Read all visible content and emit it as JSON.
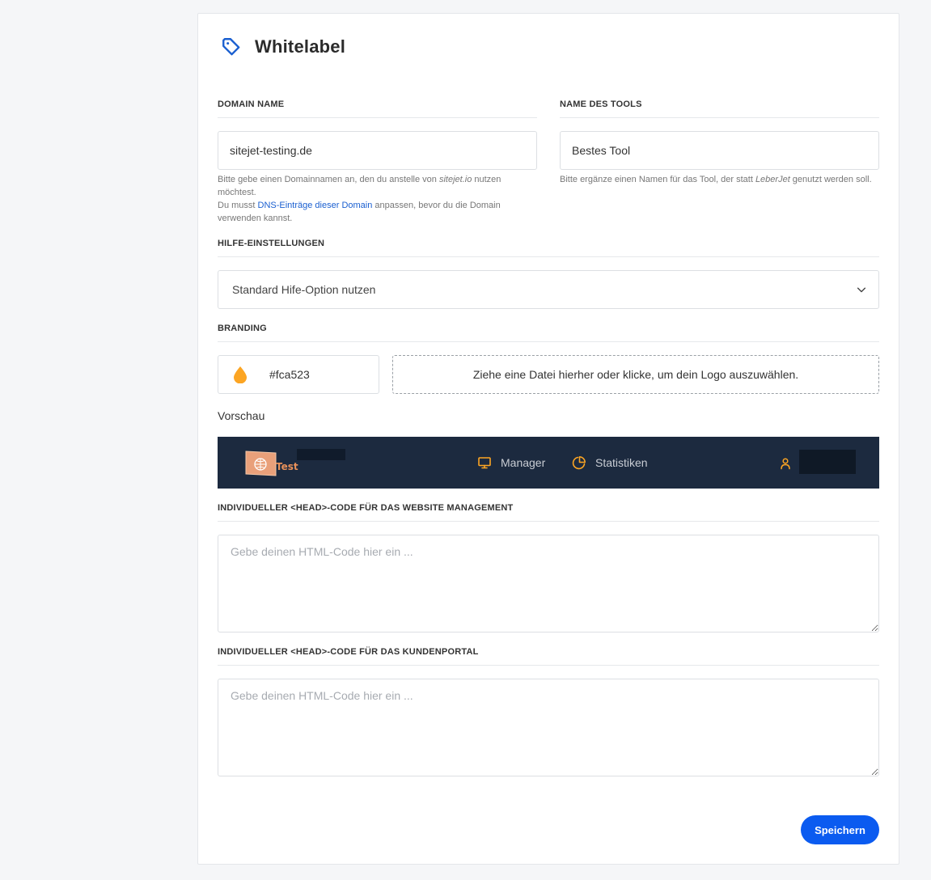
{
  "header": {
    "title": "Whitelabel",
    "icon": "tag-icon",
    "accent": "#1a5fd0"
  },
  "domain": {
    "label": "DOMAIN NAME",
    "value": "sitejet-testing.de",
    "help_part1": "Bitte gebe einen Domainnamen an, den du anstelle von ",
    "help_italic": "sitejet.io",
    "help_part2": " nutzen möchtest.",
    "help_line2_prefix": "Du musst ",
    "help_link": "DNS-Einträge dieser Domain",
    "help_line2_suffix": " anpassen, bevor du die Domain verwenden kannst."
  },
  "tool_name": {
    "label": "NAME DES TOOLS",
    "value": "Bestes Tool",
    "help_part1": "Bitte ergänze einen Namen für das Tool, der statt ",
    "help_italic": "LeberJet",
    "help_part2": " genutzt werden soll."
  },
  "help_settings": {
    "label": "HILFE-EINSTELLUNGEN",
    "selected": "Standard Hife-Option nutzen"
  },
  "branding": {
    "label": "BRANDING",
    "color_value": "#fca523",
    "color": "#fca523",
    "dropzone_text": "Ziehe eine Datei hierher oder klicke, um dein Logo auszuwählen."
  },
  "preview": {
    "label": "Vorschau",
    "logo_text": "Test",
    "nav": [
      {
        "label": "Manager",
        "icon": "monitor-icon"
      },
      {
        "label": "Statistiken",
        "icon": "pie-chart-icon"
      }
    ],
    "user_icon": "user-icon",
    "bar_color": "#1c2a3f",
    "icon_color": "#fca523"
  },
  "head_code_management": {
    "label": "INDIVIDUELLER <HEAD>-CODE FÜR DAS WEBSITE MANAGEMENT",
    "placeholder": "Gebe deinen HTML-Code hier ein ..."
  },
  "head_code_portal": {
    "label": "INDIVIDUELLER <HEAD>-CODE FÜR DAS KUNDENPORTAL",
    "placeholder": "Gebe deinen HTML-Code hier ein ..."
  },
  "actions": {
    "save_label": "Speichern",
    "save_color": "#0b5bf0"
  }
}
